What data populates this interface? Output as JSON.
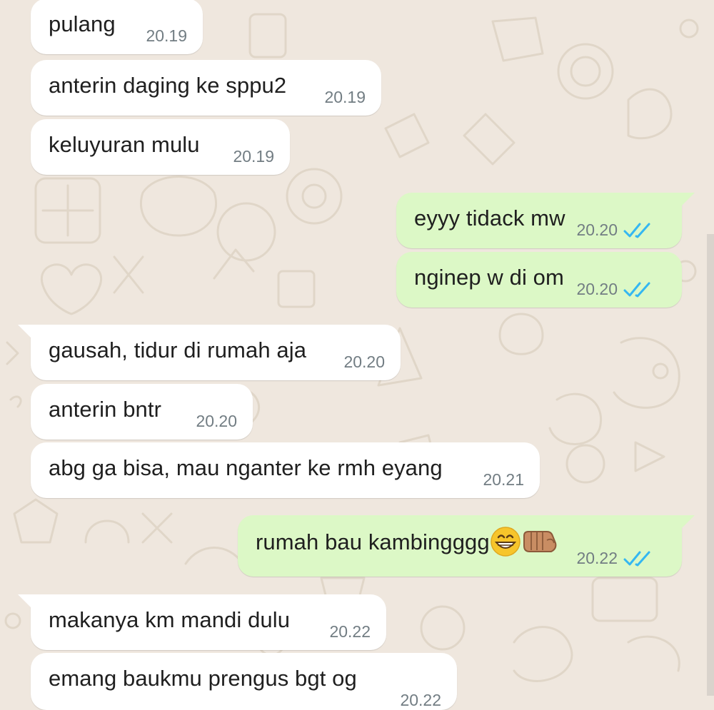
{
  "colors": {
    "wallpaper": "#efe7de",
    "incoming_bubble": "#ffffff",
    "outgoing_bubble": "#dcf8c6",
    "timestamp": "#727d83",
    "read_ticks": "#34b7f1",
    "text": "#1f1f1f"
  },
  "messages": [
    {
      "dir": "in",
      "text": "pulang",
      "time": "20.19"
    },
    {
      "dir": "in",
      "text": "anterin daging ke sppu2",
      "time": "20.19"
    },
    {
      "dir": "in",
      "text": "keluyuran mulu",
      "time": "20.19"
    },
    {
      "dir": "out",
      "text": "eyyy tidack mw",
      "time": "20.20",
      "status": "read"
    },
    {
      "dir": "out",
      "text": "nginep w di om",
      "time": "20.20",
      "status": "read"
    },
    {
      "dir": "in",
      "text": "gausah, tidur di rumah aja",
      "time": "20.20"
    },
    {
      "dir": "in",
      "text": "anterin bntr",
      "time": "20.20"
    },
    {
      "dir": "in",
      "text": "abg ga bisa, mau nganter ke rmh eyang",
      "time": "20.21"
    },
    {
      "dir": "out",
      "text": "rumah bau kambingggg",
      "emojis": [
        "grinning-face-icon",
        "fist-bump-icon"
      ],
      "time": "20.22",
      "status": "read"
    },
    {
      "dir": "in",
      "text": "makanya km mandi dulu",
      "time": "20.22"
    },
    {
      "dir": "in",
      "text": "emang baukmu prengus bgt og",
      "time": "20.22"
    }
  ]
}
